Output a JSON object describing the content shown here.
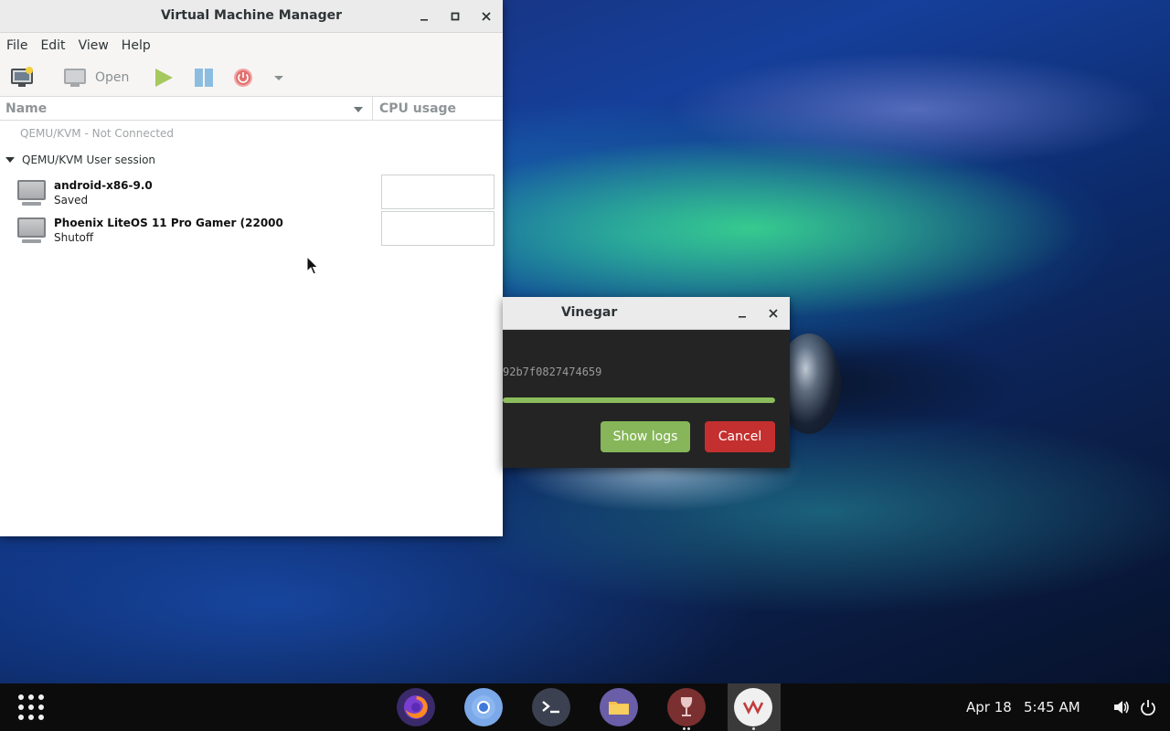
{
  "vmm": {
    "title": "Virtual Machine Manager",
    "menu": [
      "File",
      "Edit",
      "View",
      "Help"
    ],
    "toolbar": {
      "open_label": "Open"
    },
    "columns": {
      "name": "Name",
      "cpu": "CPU usage"
    },
    "connections": [
      {
        "label": "QEMU/KVM - Not Connected",
        "state": "disconnected"
      },
      {
        "label": "QEMU/KVM User session",
        "state": "expanded"
      }
    ],
    "vms": [
      {
        "name": "android-x86-9.0",
        "status": "Saved"
      },
      {
        "name": "Phoenix LiteOS 11 Pro Gamer (22000",
        "status": "Shutoff"
      }
    ]
  },
  "vinegar": {
    "title": "Vinegar",
    "hash_text": "92b7f0827474659",
    "progress": 1.0,
    "show_logs_label": "Show logs",
    "cancel_label": "Cancel"
  },
  "taskbar": {
    "date": "Apr 18",
    "time": "5:45 AM",
    "dock": [
      "firefox-icon",
      "chromium-icon",
      "terminal-icon",
      "files-icon",
      "wine-glass-icon",
      "virt-manager-icon"
    ]
  },
  "colors": {
    "accent_green": "#86b659",
    "cancel_red": "#c4302f",
    "progress_green": "#8bbd5d"
  }
}
